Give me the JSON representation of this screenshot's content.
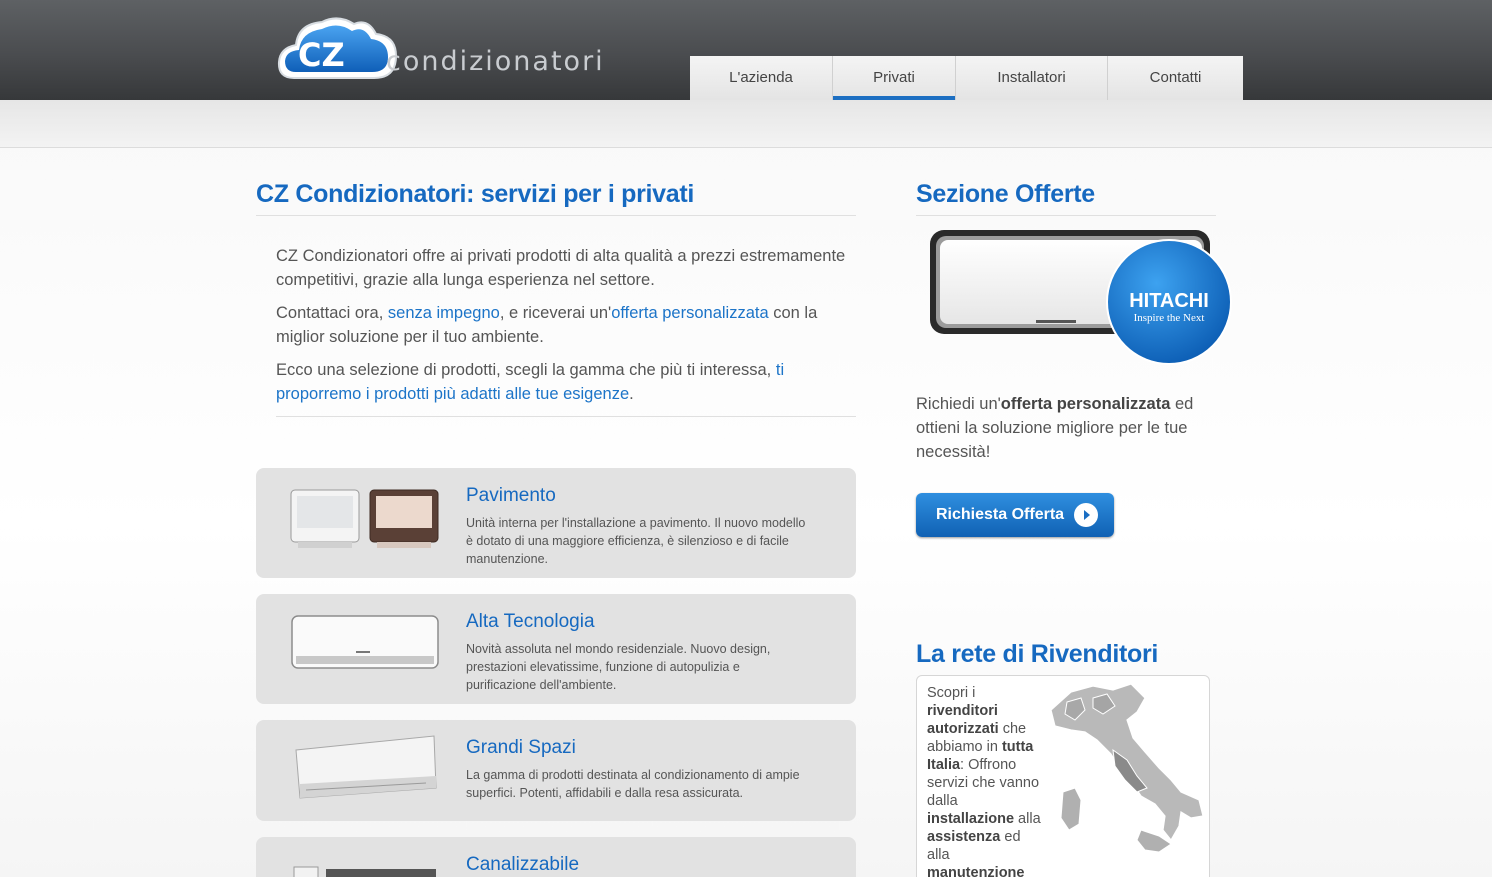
{
  "header": {
    "logo_badge": "CZ",
    "logo_text": "condizionatori",
    "nav": [
      {
        "label": "L'azienda",
        "active": false
      },
      {
        "label": "Privati",
        "active": true
      },
      {
        "label": "Installatori",
        "active": false
      },
      {
        "label": "Contatti",
        "active": false
      }
    ]
  },
  "main": {
    "title": "CZ Condizionatori: servizi per i privati",
    "intro": {
      "p1": "CZ Condizionatori offre ai privati prodotti di alta qualità a prezzi estremamente competitivi, grazie alla lunga esperienza nel settore.",
      "p2_before": "Contattaci ora, ",
      "p2_link1": "senza impegno",
      "p2_middle": ", e riceverai un'",
      "p2_link2": "offerta personalizzata",
      "p2_after": " con la miglior soluzione per il tuo ambiente.",
      "p3_before": "Ecco una selezione di prodotti, scegli la gamma che più ti interessa, ",
      "p3_link": "ti proporremo i prodotti più adatti alle tue esigenze",
      "p3_after": "."
    },
    "products": [
      {
        "title": "Pavimento",
        "description": "Unità interna per l'installazione a pavimento. Il nuovo modello è dotato di una maggiore efficienza, è silenzioso e di facile manutenzione."
      },
      {
        "title": "Alta Tecnologia",
        "description": "Novità assoluta nel mondo residenziale. Nuovo design, prestazioni elevatissime, funzione di autopulizia e purificazione dell'ambiente."
      },
      {
        "title": "Grandi Spazi",
        "description": "La gamma di prodotti destinata al condizionamento di ampie superfici. Potenti, affidabili e dalla resa assicurata."
      },
      {
        "title": "Canalizzabile",
        "description": ""
      }
    ]
  },
  "sidebar": {
    "offers_title": "Sezione Offerte",
    "brand_name": "HITACHI",
    "brand_tagline": "Inspire the Next",
    "offer_text_before": "Richiedi un'",
    "offer_text_bold": "offerta personalizzata",
    "offer_text_after": " ed ottieni la soluzione migliore per le tue necessità!",
    "offer_button": "Richiesta Offerta",
    "dealers_title": "La rete di Rivenditori",
    "dealers_text": {
      "t1": "Scopri i ",
      "b1": "rivenditori autorizzati",
      "t2": " che abbiamo in ",
      "b2": "tutta Italia",
      "t3": ": Offrono servizi che vanno dalla ",
      "b3": "installazione",
      "t4": " alla ",
      "b4": "assistenza",
      "t5": " ed alla ",
      "b5": "manutenzione"
    }
  },
  "colors": {
    "accent": "#1669c0",
    "link": "#1c74c8",
    "header_dark": "#3a3c3f"
  }
}
